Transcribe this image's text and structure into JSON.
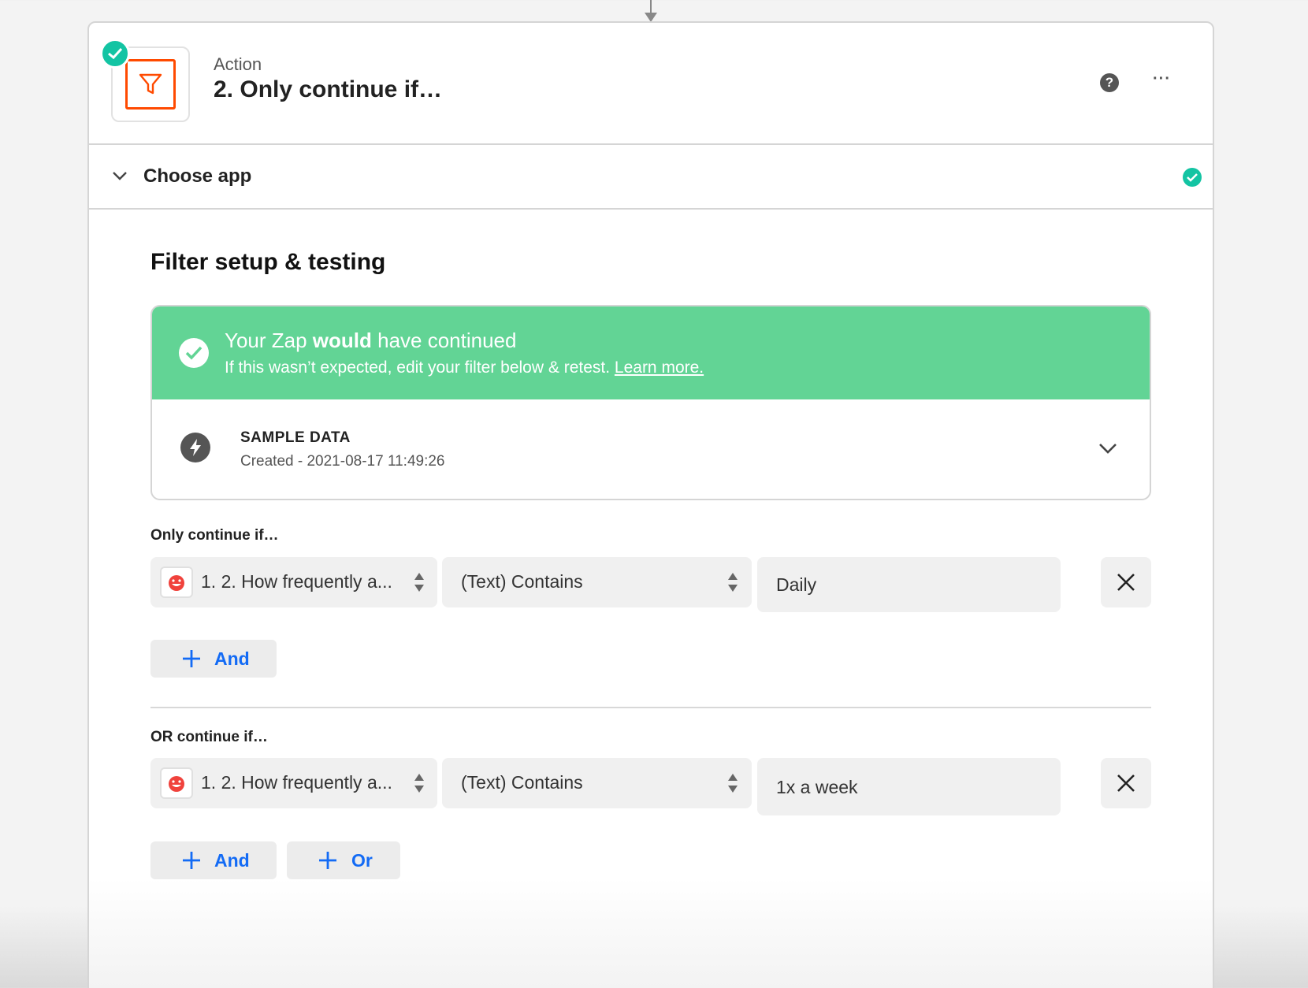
{
  "step": {
    "kind": "Action",
    "title": "2. Only continue if…",
    "app_icon": "filter-funnel-icon",
    "accent_color": "#ff4a00"
  },
  "header_actions": {
    "help_icon": "question-mark-circle-icon",
    "help_glyph": "?",
    "more_icon": "ellipsis-icon",
    "more_glyph": "···"
  },
  "choose_app": {
    "label": "Choose app",
    "status": "complete"
  },
  "filter_section": {
    "title": "Filter setup & testing"
  },
  "test_result": {
    "headline_pre": "Your Zap ",
    "headline_bold": "would",
    "headline_post": " have continued",
    "subtext": "If this wasn’t expected, edit your filter below & retest. ",
    "link_text": "Learn more.",
    "banner_color": "#62d495"
  },
  "sample_data": {
    "title": "SAMPLE DATA",
    "subtitle": "Created - 2021-08-17 11:49:26"
  },
  "groups": [
    {
      "label": "Only continue if…",
      "rule": {
        "field": "1. 2. How frequently a...",
        "condition": "(Text) Contains",
        "value": "Daily"
      },
      "buttons": [
        "And"
      ]
    },
    {
      "label": "OR continue if…",
      "rule": {
        "field": "1. 2. How frequently a...",
        "condition": "(Text) Contains",
        "value": "1x a week"
      },
      "buttons": [
        "And",
        "Or"
      ]
    }
  ],
  "colors": {
    "success": "#13c4a3",
    "link_blue": "#136bf5"
  }
}
